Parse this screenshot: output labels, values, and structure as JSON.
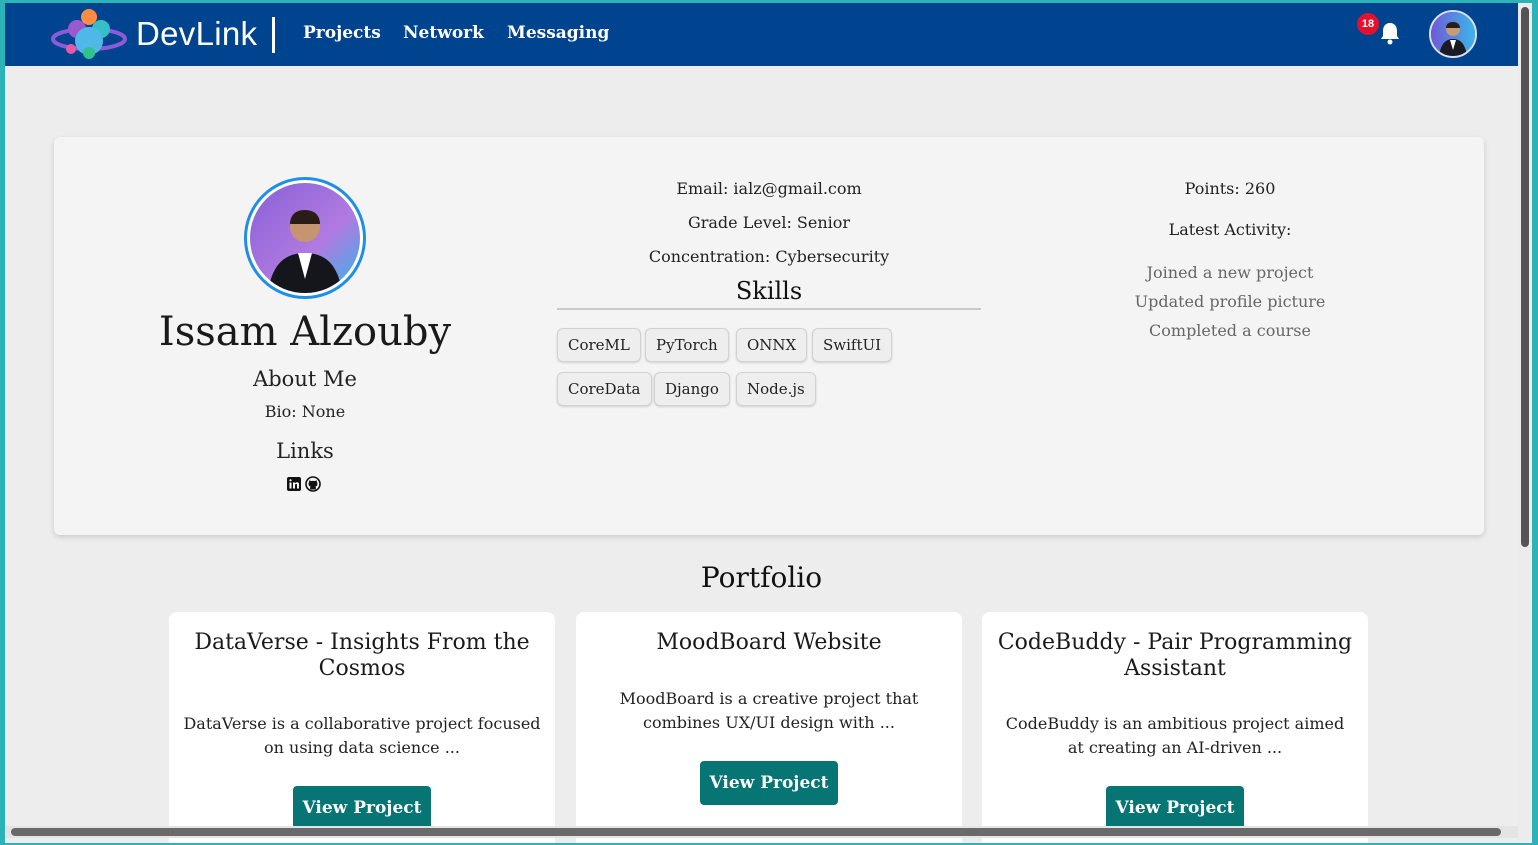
{
  "nav": {
    "brand": "DevLink",
    "links": [
      "Projects",
      "Network",
      "Messaging"
    ],
    "notification_count": "18",
    "icons": {
      "bell": "bell-icon",
      "avatar": "user-avatar"
    }
  },
  "profile": {
    "name": "Issam Alzouby",
    "about_title": "About Me",
    "bio": "Bio: None",
    "links_title": "Links",
    "link_icons": [
      "linkedin-icon",
      "github-icon"
    ],
    "email": "Email: ialz@gmail.com",
    "grade": "Grade Level: Senior",
    "concentration": "Concentration: Cybersecurity",
    "skills_title": "Skills",
    "skills": [
      "CoreML",
      "PyTorch",
      "ONNX",
      "SwiftUI",
      "CoreData",
      "Django",
      "Node.js"
    ],
    "points": "Points: 260",
    "latest_activity_title": "Latest Activity:",
    "activities": [
      "Joined a new project",
      "Updated profile picture",
      "Completed a course"
    ]
  },
  "portfolio": {
    "title": "Portfolio",
    "projects": [
      {
        "title": "DataVerse - Insights From the Cosmos",
        "desc": "DataVerse is a collaborative project focused on using data science ...",
        "button": "View Project"
      },
      {
        "title": "MoodBoard Website",
        "desc": "MoodBoard is a creative project that combines UX/UI design with ...",
        "button": "View Project"
      },
      {
        "title": "CodeBuddy - Pair Programming Assistant",
        "desc": "CodeBuddy is an ambitious project aimed at creating an AI-driven ...",
        "button": "View Project"
      }
    ]
  },
  "colors": {
    "navbar": "#00448f",
    "button": "#087575",
    "badge": "#e3112f",
    "avatar_ring": "#1e8fe6"
  }
}
